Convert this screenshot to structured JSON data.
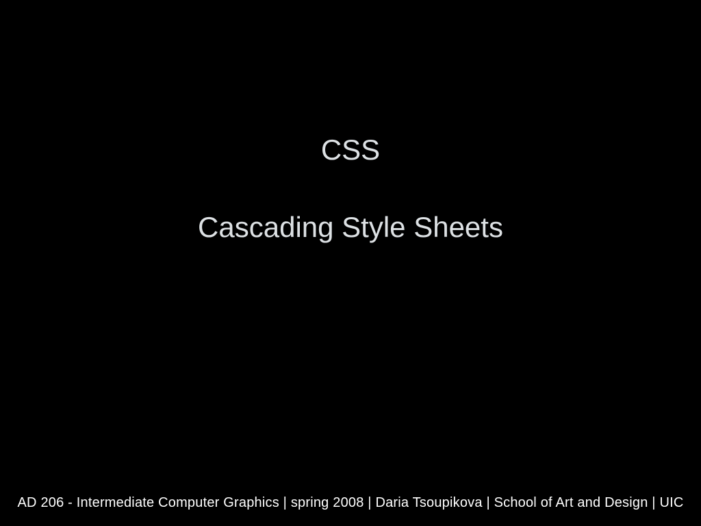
{
  "slide": {
    "title_line1": "CSS",
    "title_line2": "Cascading Style Sheets",
    "footer": "AD 206  -  Intermediate Computer Graphics |  spring 2008 | Daria Tsoupikova | School of Art and Design |  UIC"
  },
  "colors": {
    "background": "#000000",
    "text_muted": "#dde1e4",
    "text_footer": "#ffffff"
  }
}
